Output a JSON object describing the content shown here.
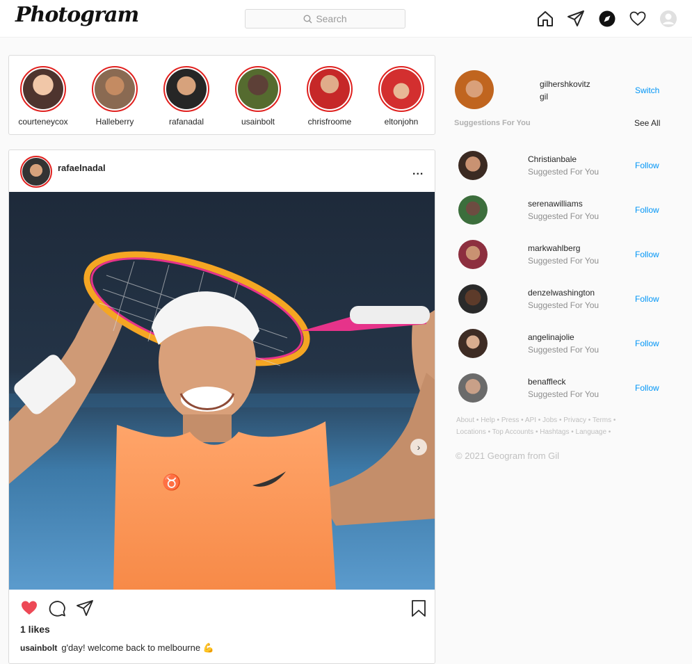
{
  "header": {
    "logo": "Photogram",
    "search_placeholder": "Search",
    "nav": [
      "home-icon",
      "direct-icon",
      "explore-icon",
      "activity-icon",
      "profile-icon"
    ]
  },
  "stories": [
    {
      "name": "courteneycox",
      "color": "#6d4c41"
    },
    {
      "name": "Halleberry",
      "color": "#a1887f"
    },
    {
      "name": "rafanadal",
      "color": "#8d6e63"
    },
    {
      "name": "usainbolt",
      "color": "#4e342e"
    },
    {
      "name": "chrisfroome",
      "color": "#b71c1c"
    },
    {
      "name": "eltonjohn",
      "color": "#d32f2f"
    }
  ],
  "post": {
    "username": "rafaelnadal",
    "more_label": "...",
    "likes": "1 likes",
    "caption_user": "usainbolt",
    "caption_text": "g'day! welcome back to melbourne 💪"
  },
  "sidebar": {
    "me": {
      "username": "gilhershkovitz",
      "name": "gil",
      "switch_label": "Switch"
    },
    "suggestions_title": "Suggestions For You",
    "see_all": "See All",
    "suggestions": [
      {
        "username": "Christianbale",
        "subtitle": "Suggested For You",
        "action": "Follow",
        "color": "#5d4037"
      },
      {
        "username": "serenawilliams",
        "subtitle": "Suggested For You",
        "action": "Follow",
        "color": "#3e2723"
      },
      {
        "username": "markwahlberg",
        "subtitle": "Suggested For You",
        "action": "Follow",
        "color": "#8d2f2f"
      },
      {
        "username": "denzelwashington",
        "subtitle": "Suggested For You",
        "action": "Follow",
        "color": "#4e342e"
      },
      {
        "username": "angelinajolie",
        "subtitle": "Suggested For You",
        "action": "Follow",
        "color": "#6d4c41"
      },
      {
        "username": "benaffleck",
        "subtitle": "Suggested For You",
        "action": "Follow",
        "color": "#795548"
      }
    ],
    "footer_links_1": "About • Help • Press • API • Jobs • Privacy • Terms •",
    "footer_links_2": "Locations • Top Accounts • Hashtags • Language •",
    "copyright": "© 2021 Geogram from Gil"
  }
}
